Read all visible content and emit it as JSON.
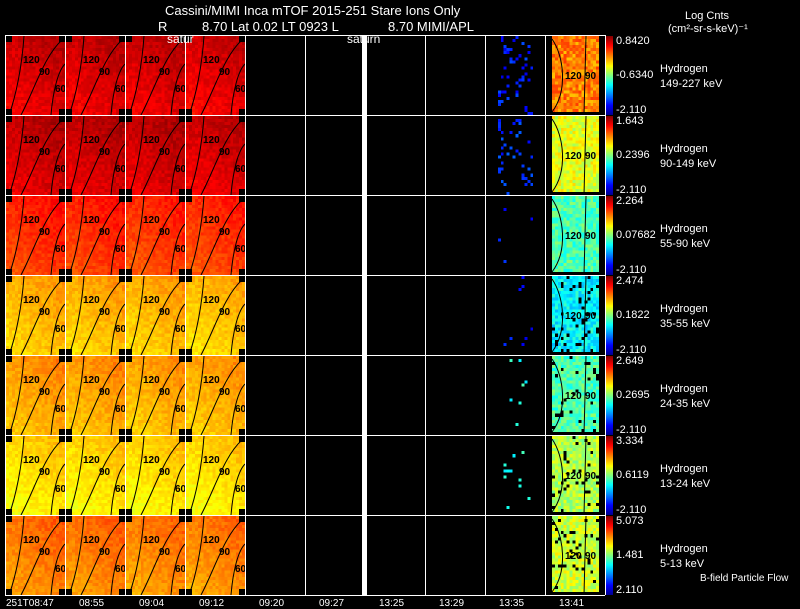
{
  "header": {
    "line1": "Cassini/MIMI Inca mTOF  2015-251    Stare    Ions Only",
    "line2_r": "R",
    "line2_rest": "8.70 Lat 0.02 LT 0923 L",
    "line2_l": "8.70  MIMI/APL",
    "overlay_left": "satur",
    "overlay_mid": "saturn"
  },
  "units": {
    "line1": "Log Cnts",
    "line2": "(cm²-sr-s-keV)⁻¹"
  },
  "footer_note": "B-field Particle Flow",
  "contour_labels": {
    "a": "120",
    "b": "90",
    "c": "60"
  },
  "chart_data": {
    "type": "heatmap",
    "title": "Cassini/MIMI Inca mTOF 2015-251 Stare Ions Only",
    "x_tick_labels": [
      "251T08:47",
      "08:55",
      "09:04",
      "09:12",
      "09:20",
      "09:27",
      "13:25",
      "13:29",
      "13:35",
      "13:41"
    ],
    "colorbar_label": "Log Cnts (cm²-sr-s-keV)⁻¹",
    "rows": [
      {
        "species": "Hydrogen",
        "energy": "149-227 keV",
        "cmax": "0.8420",
        "cmid": "-0.6340",
        "cmin": "-2.110"
      },
      {
        "species": "Hydrogen",
        "energy": "90-149 keV",
        "cmax": "1.643",
        "cmid": "0.2396",
        "cmin": "-2.110"
      },
      {
        "species": "Hydrogen",
        "energy": "55-90 keV",
        "cmax": "2.264",
        "cmid": "0.07682",
        "cmin": "-2.110"
      },
      {
        "species": "Hydrogen",
        "energy": "35-55 keV",
        "cmax": "2.474",
        "cmid": "0.1822",
        "cmin": "-2.110"
      },
      {
        "species": "Hydrogen",
        "energy": "24-35 keV",
        "cmax": "2.649",
        "cmid": "0.2695",
        "cmin": "-2.110"
      },
      {
        "species": "Hydrogen",
        "energy": "13-24 keV",
        "cmax": "3.334",
        "cmid": "0.6119",
        "cmin": "-2.110"
      },
      {
        "species": "Hydrogen",
        "energy": "5-13 keV",
        "cmax": "5.073",
        "cmid": "1.481",
        "cmin": "2.110"
      }
    ],
    "panel_levels_relative": [
      [
        0.92,
        0.92,
        0.92,
        0.91,
        null,
        null,
        null,
        null,
        0.1,
        0.75
      ],
      [
        0.93,
        0.93,
        0.93,
        0.92,
        null,
        null,
        null,
        null,
        0.12,
        0.6
      ],
      [
        0.84,
        0.84,
        0.83,
        0.83,
        null,
        null,
        null,
        null,
        0.1,
        0.45
      ],
      [
        0.7,
        0.7,
        0.7,
        0.69,
        null,
        null,
        null,
        null,
        0.1,
        0.37
      ],
      [
        0.72,
        0.72,
        0.71,
        0.71,
        null,
        null,
        null,
        null,
        0.35,
        0.45
      ],
      [
        0.66,
        0.66,
        0.66,
        0.66,
        null,
        null,
        null,
        null,
        0.35,
        0.55
      ],
      [
        0.76,
        0.76,
        0.75,
        0.75,
        null,
        null,
        null,
        null,
        null,
        0.58
      ]
    ]
  }
}
